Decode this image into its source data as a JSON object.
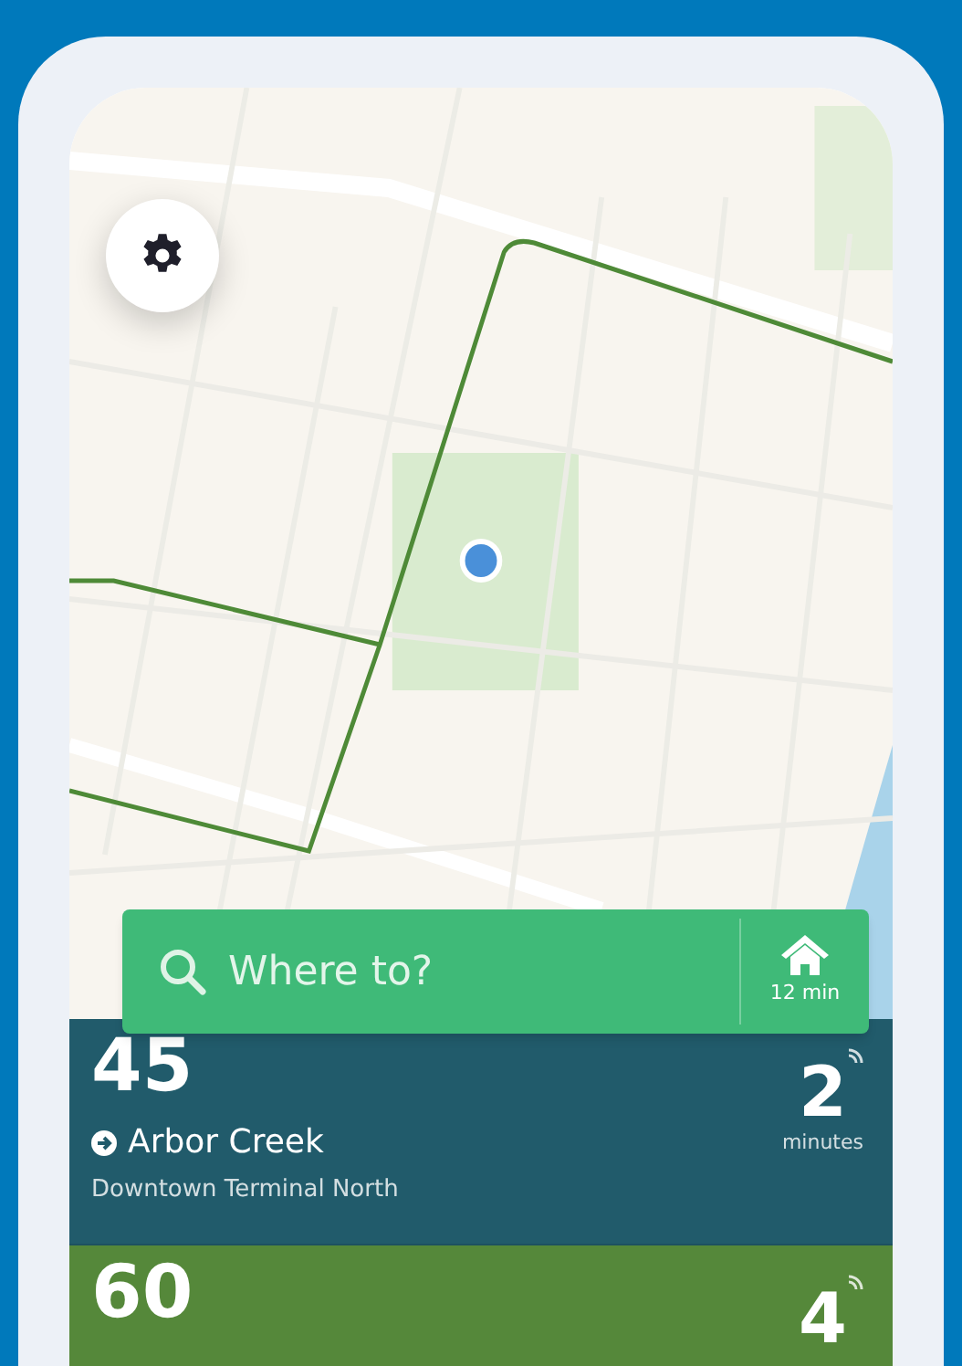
{
  "search": {
    "placeholder": "Where to?"
  },
  "home_shortcut": {
    "label": "12 min"
  },
  "departures": [
    {
      "route": "45",
      "destination": "Arbor Creek",
      "stop": "Downtown Terminal North",
      "eta": "2",
      "unit": "minutes",
      "color": "#215b6b"
    },
    {
      "route": "60",
      "eta": "4",
      "color": "#55883a"
    }
  ]
}
